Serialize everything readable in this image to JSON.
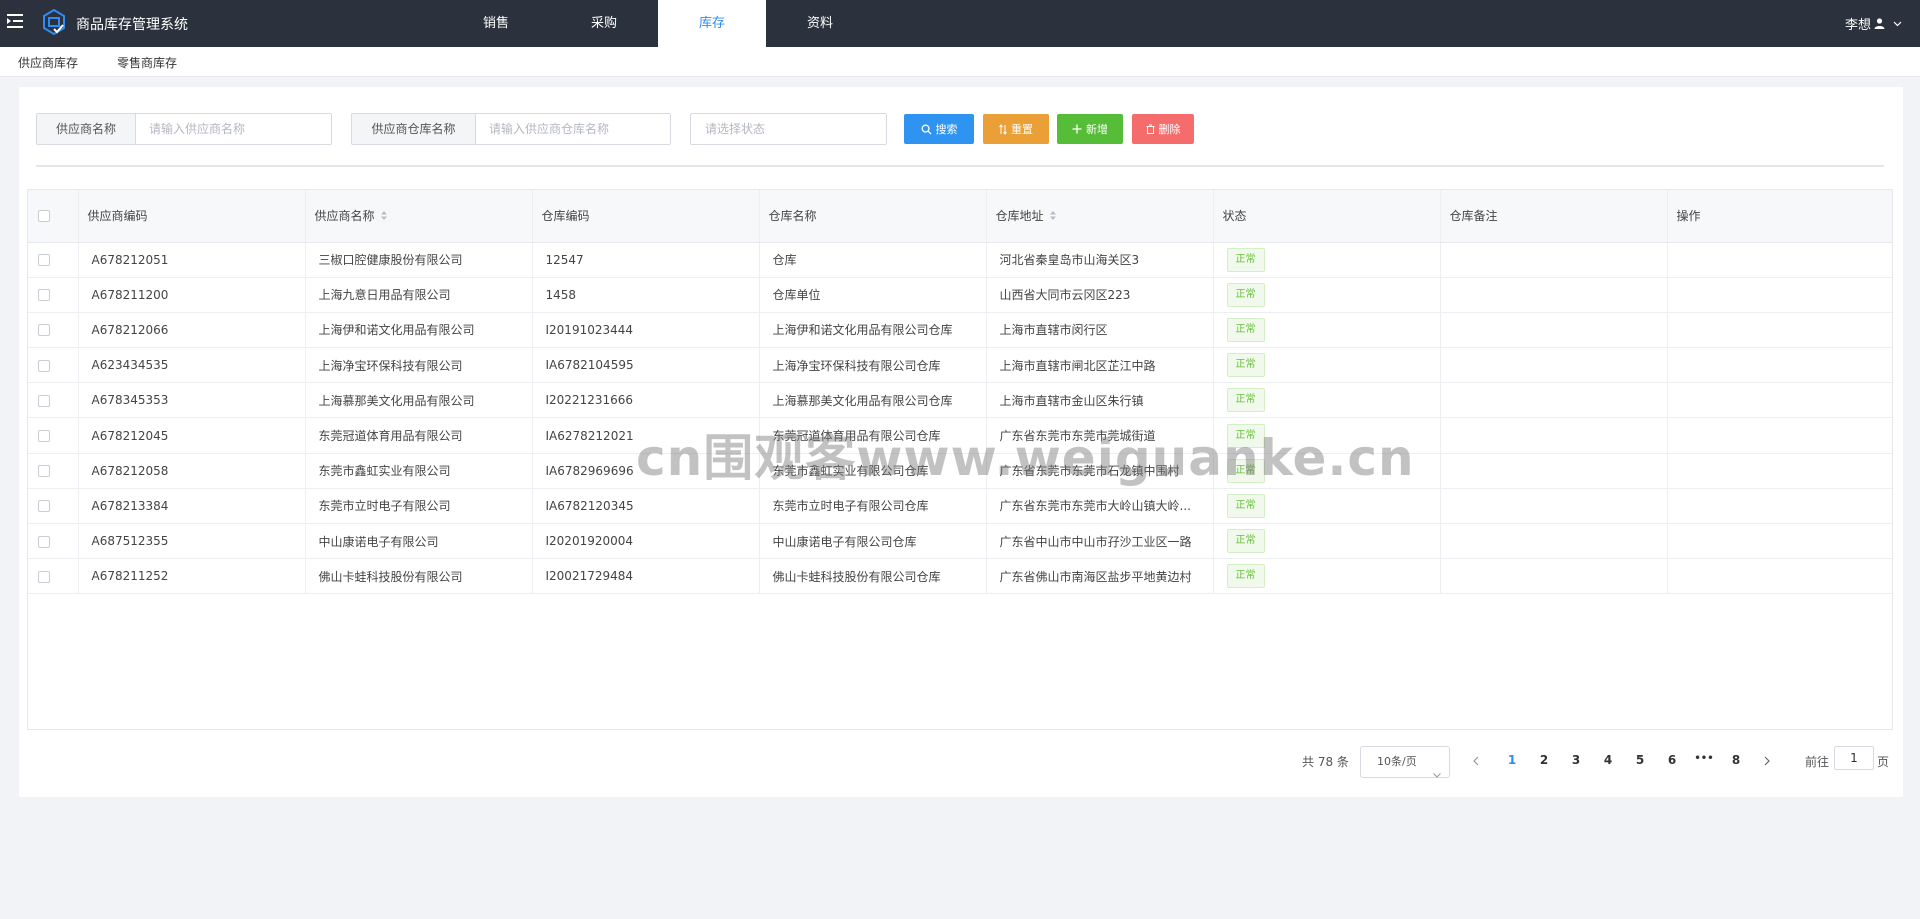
{
  "header": {
    "app_title": "商品库存管理系统",
    "nav": [
      {
        "label": "销售",
        "active": false
      },
      {
        "label": "采购",
        "active": false
      },
      {
        "label": "库存",
        "active": true
      },
      {
        "label": "资料",
        "active": false
      }
    ],
    "user_name": "李想",
    "accent_color": "#2f8cf0",
    "bar_color": "#2b313d"
  },
  "subnav": {
    "items": [
      "供应商库存",
      "零售商库存"
    ]
  },
  "filters": {
    "supplier_label": "供应商名称",
    "supplier_placeholder": "请输入供应商名称",
    "warehouse_label": "供应商仓库名称",
    "warehouse_placeholder": "请输入供应商仓库名称",
    "status_placeholder": "请选择状态"
  },
  "buttons": {
    "search": "搜索",
    "reset": "重置",
    "add": "新增",
    "delete": "删除"
  },
  "table": {
    "columns": [
      "供应商编码",
      "供应商名称",
      "仓库编码",
      "仓库名称",
      "仓库地址",
      "状态",
      "仓库备注",
      "操作"
    ],
    "sortable": [
      "供应商名称",
      "仓库地址"
    ],
    "rows": [
      {
        "code": "A678212051",
        "name": "三椒口腔健康股份有限公司",
        "wh_code": "12547",
        "wh_name": "仓库",
        "address": "河北省秦皇岛市山海关区3",
        "status": "正常",
        "remark": "",
        "action": ""
      },
      {
        "code": "A678211200",
        "name": "上海九意日用品有限公司",
        "wh_code": "1458",
        "wh_name": "仓库单位",
        "address": "山西省大同市云冈区223",
        "status": "正常",
        "remark": "",
        "action": ""
      },
      {
        "code": "A678212066",
        "name": "上海伊和诺文化用品有限公司",
        "wh_code": "I20191023444",
        "wh_name": "上海伊和诺文化用品有限公司仓库",
        "address": "上海市直辖市闵行区",
        "status": "正常",
        "remark": "",
        "action": ""
      },
      {
        "code": "A623434535",
        "name": "上海净宝环保科技有限公司",
        "wh_code": "IA6782104595",
        "wh_name": "上海净宝环保科技有限公司仓库",
        "address": "上海市直辖市闸北区芷江中路",
        "status": "正常",
        "remark": "",
        "action": ""
      },
      {
        "code": "A678345353",
        "name": "上海慕那美文化用品有限公司",
        "wh_code": "I20221231666",
        "wh_name": "上海慕那美文化用品有限公司仓库",
        "address": "上海市直辖市金山区朱行镇",
        "status": "正常",
        "remark": "",
        "action": ""
      },
      {
        "code": "A678212045",
        "name": "东莞冠道体育用品有限公司",
        "wh_code": "IA6278212021",
        "wh_name": "东莞冠道体育用品有限公司仓库",
        "address": "广东省东莞市东莞市莞城街道",
        "status": "正常",
        "remark": "",
        "action": ""
      },
      {
        "code": "A678212058",
        "name": "东莞市鑫虹实业有限公司",
        "wh_code": "IA6782969696",
        "wh_name": "东莞市鑫虹实业有限公司仓库",
        "address": "广东省东莞市东莞市石龙镇中围村",
        "status": "正常",
        "remark": "",
        "action": ""
      },
      {
        "code": "A678213384",
        "name": "东莞市立时电子有限公司",
        "wh_code": "IA6782120345",
        "wh_name": "东莞市立时电子有限公司仓库",
        "address": "广东省东莞市东莞市大岭山镇大岭...",
        "status": "正常",
        "remark": "",
        "action": ""
      },
      {
        "code": "A687512355",
        "name": "中山康诺电子有限公司",
        "wh_code": "I20201920004",
        "wh_name": "中山康诺电子有限公司仓库",
        "address": "广东省中山市中山市孖沙工业区一路",
        "status": "正常",
        "remark": "",
        "action": ""
      },
      {
        "code": "A678211252",
        "name": "佛山卡蛙科技股份有限公司",
        "wh_code": "I20021729484",
        "wh_name": "佛山卡蛙科技股份有限公司仓库",
        "address": "广东省佛山市南海区盐步平地黄边村",
        "status": "正常",
        "remark": "",
        "action": ""
      }
    ]
  },
  "pagination": {
    "total_text": "共 78 条",
    "page_size": "10条/页",
    "pages": [
      "1",
      "2",
      "3",
      "4",
      "5",
      "6",
      "•••",
      "8"
    ],
    "current_page": "1",
    "goto_label": "前往",
    "goto_value": "1",
    "page_unit": "页"
  },
  "watermark": "cn围观客www.weiguanke.cn"
}
